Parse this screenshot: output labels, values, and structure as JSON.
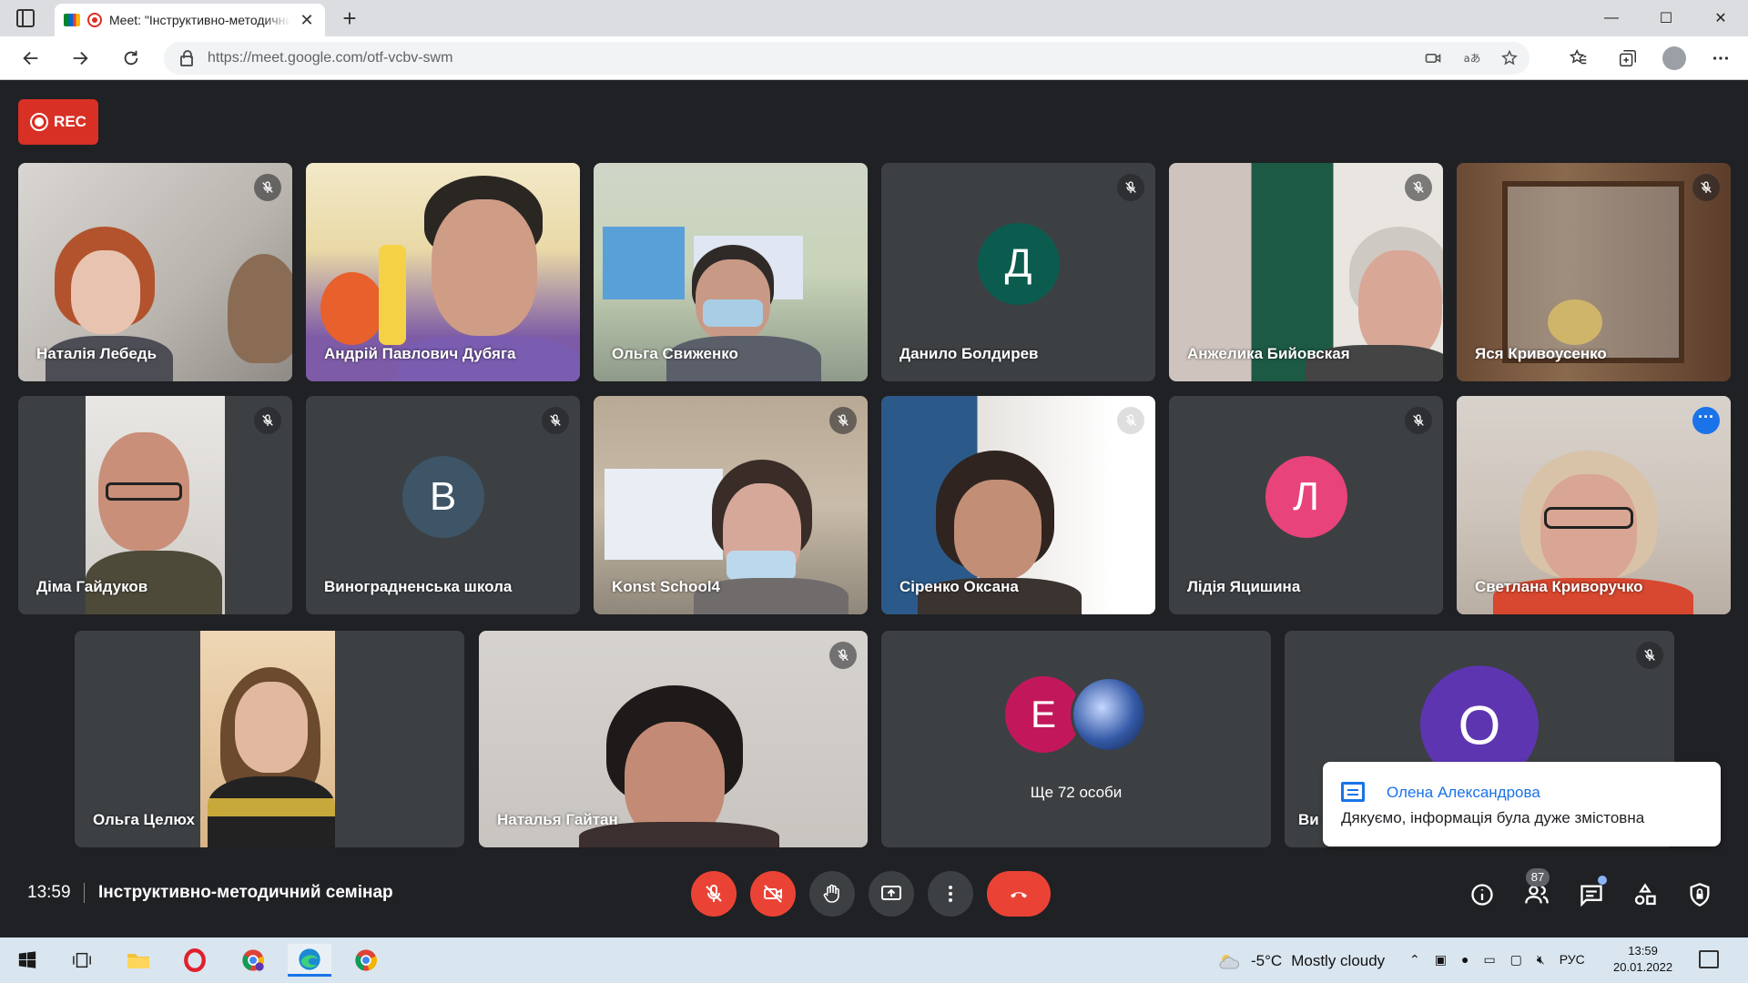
{
  "browser": {
    "tab_title": "Meet: \"Інструктивно-методичний семінар\"",
    "url": "https://meet.google.com/otf-vcbv-swm",
    "new_tab": "+",
    "tab_close": "✕",
    "minimize": "—",
    "maximize": "☐",
    "close": "✕"
  },
  "recording": {
    "label": "REC"
  },
  "participants": [
    {
      "name": "Наталія Лебедь",
      "muted": true
    },
    {
      "name": "Андрій Павлович Дубяга",
      "muted": false
    },
    {
      "name": "Ольга Свиженко",
      "muted": false
    },
    {
      "name": "Данило Болдирев",
      "muted": true,
      "initial": "Д",
      "color": "#0b5c4f"
    },
    {
      "name": "Анжелика Бийовская",
      "muted": true
    },
    {
      "name": "Яся Кривоусенко",
      "muted": true
    },
    {
      "name": "Діма Гайдуков",
      "muted": true
    },
    {
      "name": "Виноградненська школа",
      "muted": true,
      "initial": "В",
      "color": "#3d5566"
    },
    {
      "name": "Konst School4",
      "muted": true
    },
    {
      "name": "Сіренко Оксана",
      "muted": true
    },
    {
      "name": "Лідія Яцишина",
      "muted": true,
      "initial": "Л",
      "color": "#e8437a"
    },
    {
      "name": "Светлана Криворучко",
      "muted": false,
      "active": true
    },
    {
      "name": "Ольга Целюх",
      "muted": false
    },
    {
      "name": "Наталья Гайтан",
      "muted": true
    },
    {
      "name": "Ви",
      "muted": true,
      "initial": "О",
      "color": "#5e35b1"
    }
  ],
  "more_tile": {
    "initial": "Е",
    "label": "Ще 72 особи"
  },
  "chat_toast": {
    "sender": "Олена Александрова",
    "message": "Дякуємо, інформація була дуже змістовна"
  },
  "bottom_bar": {
    "time": "13:59",
    "meeting_title": "Інструктивно-методичний семінар",
    "people_count": "87"
  },
  "taskbar": {
    "weather_temp": "-5°C",
    "weather_text": "Mostly cloudy",
    "language": "РУС",
    "clock_time": "13:59",
    "clock_date": "20.01.2022"
  },
  "colors": {
    "accent": "#1a73e8",
    "danger": "#ea4335",
    "background": "#202124",
    "tile": "#3c4043"
  }
}
